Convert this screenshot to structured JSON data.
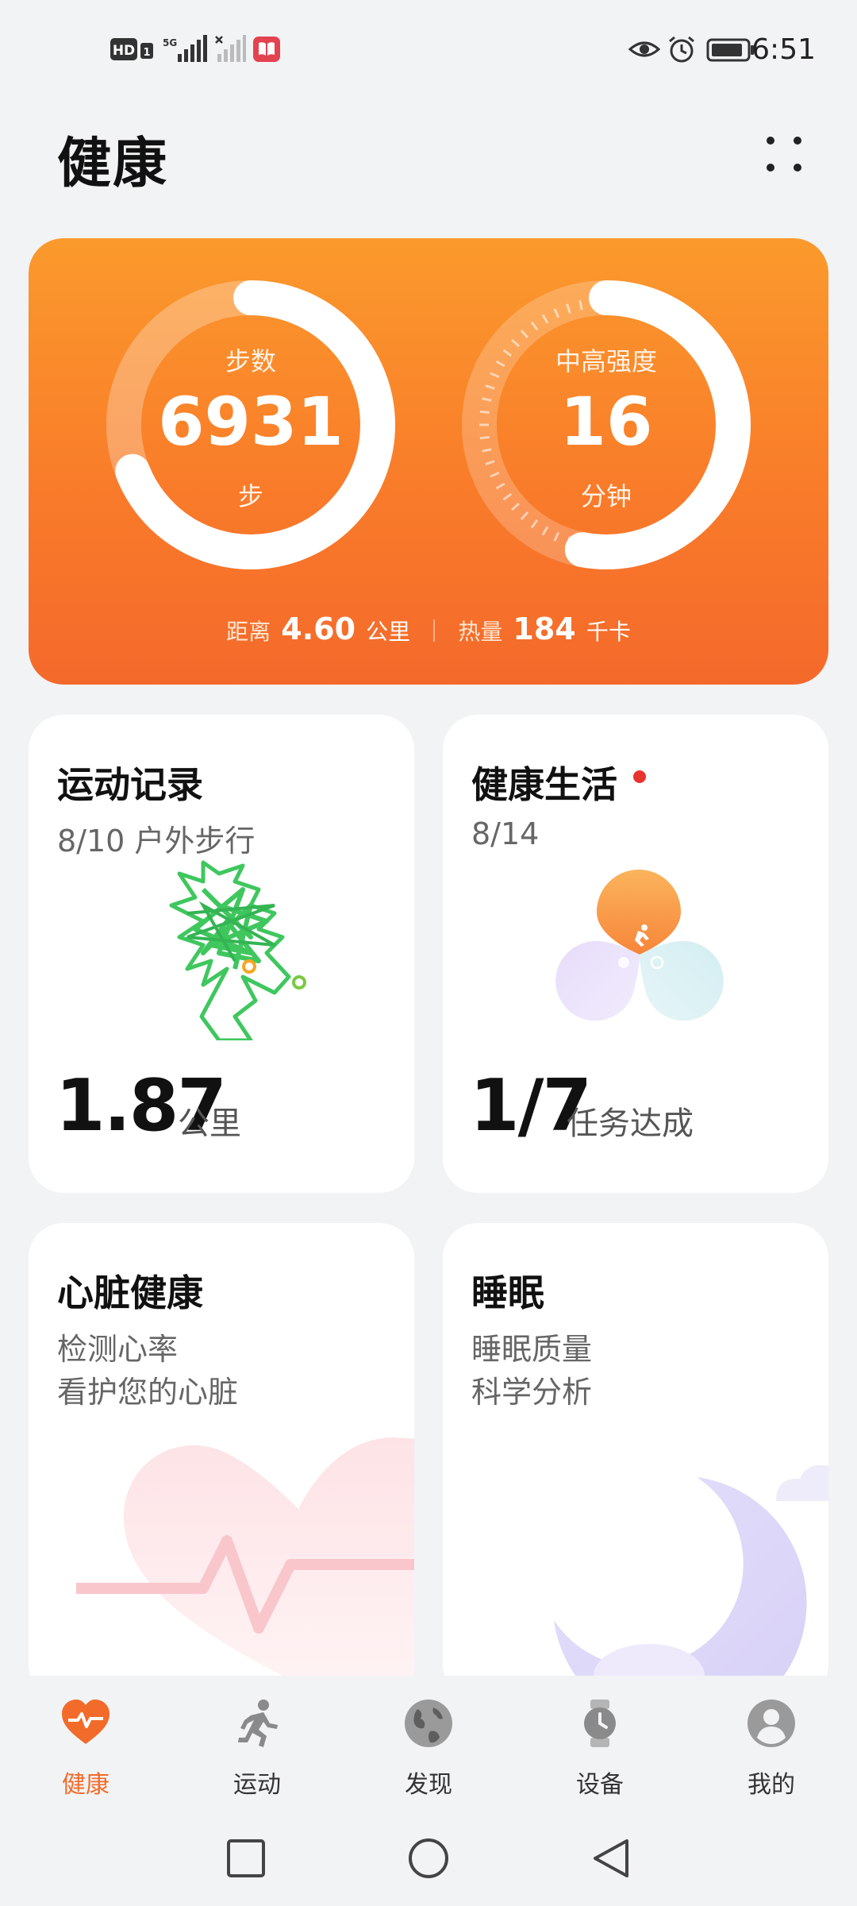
{
  "status_bar": {
    "time": "6:51",
    "left_icons": [
      "hd-icon",
      "sim-1-icon",
      "signal-5g-icon",
      "signal-no-sim-icon",
      "book-icon"
    ],
    "right_icons": [
      "eye-icon",
      "alarm-icon",
      "battery-icon"
    ],
    "hd_text": "HD",
    "sim_text": "1",
    "net_text": "5G"
  },
  "header": {
    "title": "健康",
    "more_icon": "more-dots-icon"
  },
  "hero": {
    "steps": {
      "label": "步数",
      "value": "6931",
      "unit": "步",
      "progress": 0.69
    },
    "intensity": {
      "label": "中高强度",
      "value": "16",
      "unit": "分钟",
      "progress": 0.53
    },
    "distance_label": "距离",
    "distance_value": "4.60",
    "distance_unit": "公里",
    "calorie_label": "热量",
    "calorie_value": "184",
    "calorie_unit": "千卡",
    "colors": {
      "top": "#fb9a2c",
      "bottom": "#f4692b"
    }
  },
  "cards": {
    "exercise": {
      "title": "运动记录",
      "subtitle": "8/10 户外步行",
      "value": "1.87",
      "unit": "公里",
      "track_color": "#3fc75e"
    },
    "healthy_life": {
      "title": "健康生活",
      "subtitle": "8/14",
      "value": "1/7",
      "unit": "任务达成",
      "has_badge": true,
      "badge_color": "#e8342f"
    },
    "heart": {
      "title": "心脏健康",
      "line1": "检测心率",
      "line2": "看护您的心脏"
    },
    "sleep": {
      "title": "睡眠",
      "line1": "睡眠质量",
      "line2": "科学分析"
    }
  },
  "bottom_nav": {
    "items": [
      {
        "label": "健康",
        "icon": "heart-pulse-icon",
        "active": true
      },
      {
        "label": "运动",
        "icon": "running-person-icon",
        "active": false
      },
      {
        "label": "发现",
        "icon": "globe-icon",
        "active": false
      },
      {
        "label": "设备",
        "icon": "watch-icon",
        "active": false
      },
      {
        "label": "我的",
        "icon": "profile-icon",
        "active": false
      }
    ],
    "active_color": "#f26b2a"
  },
  "system_nav": {
    "buttons": [
      "recent-apps-icon",
      "home-icon",
      "back-icon"
    ]
  }
}
